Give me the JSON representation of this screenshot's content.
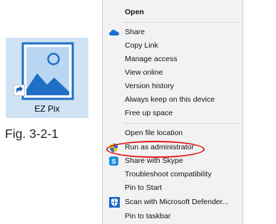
{
  "shortcut": {
    "label": "EZ Pix",
    "icon": "image-landscape-icon",
    "overlay": "shortcut-arrow-icon",
    "tile_color": "#cfe3f5",
    "icon_color": "#1f6fc4"
  },
  "caption": "Fig. 3-2-1",
  "menu": {
    "items": [
      {
        "label": "Open",
        "bold": true,
        "icon": null
      },
      {
        "label": "Share",
        "bold": false,
        "icon": "onedrive-cloud-icon"
      },
      {
        "label": "Copy Link",
        "bold": false,
        "icon": null
      },
      {
        "label": "Manage access",
        "bold": false,
        "icon": null
      },
      {
        "label": "View online",
        "bold": false,
        "icon": null
      },
      {
        "label": "Version history",
        "bold": false,
        "icon": null
      },
      {
        "label": "Always keep on this device",
        "bold": false,
        "icon": null
      },
      {
        "label": "Free up space",
        "bold": false,
        "icon": null
      },
      {
        "label": "Open file location",
        "bold": false,
        "icon": null
      },
      {
        "label": "Run as administrator",
        "bold": false,
        "icon": "uac-shield-icon"
      },
      {
        "label": "Share with Skype",
        "bold": false,
        "icon": "skype-icon"
      },
      {
        "label": "Troubleshoot compatibility",
        "bold": false,
        "icon": null
      },
      {
        "label": "Pin to Start",
        "bold": false,
        "icon": null
      },
      {
        "label": "Scan with Microsoft Defender...",
        "bold": false,
        "icon": "defender-icon"
      },
      {
        "label": "Pin to taskbar",
        "bold": false,
        "icon": null
      }
    ],
    "highlighted": "Run as administrator",
    "highlight_color": "#e01818",
    "background": "#f2f2f2"
  }
}
